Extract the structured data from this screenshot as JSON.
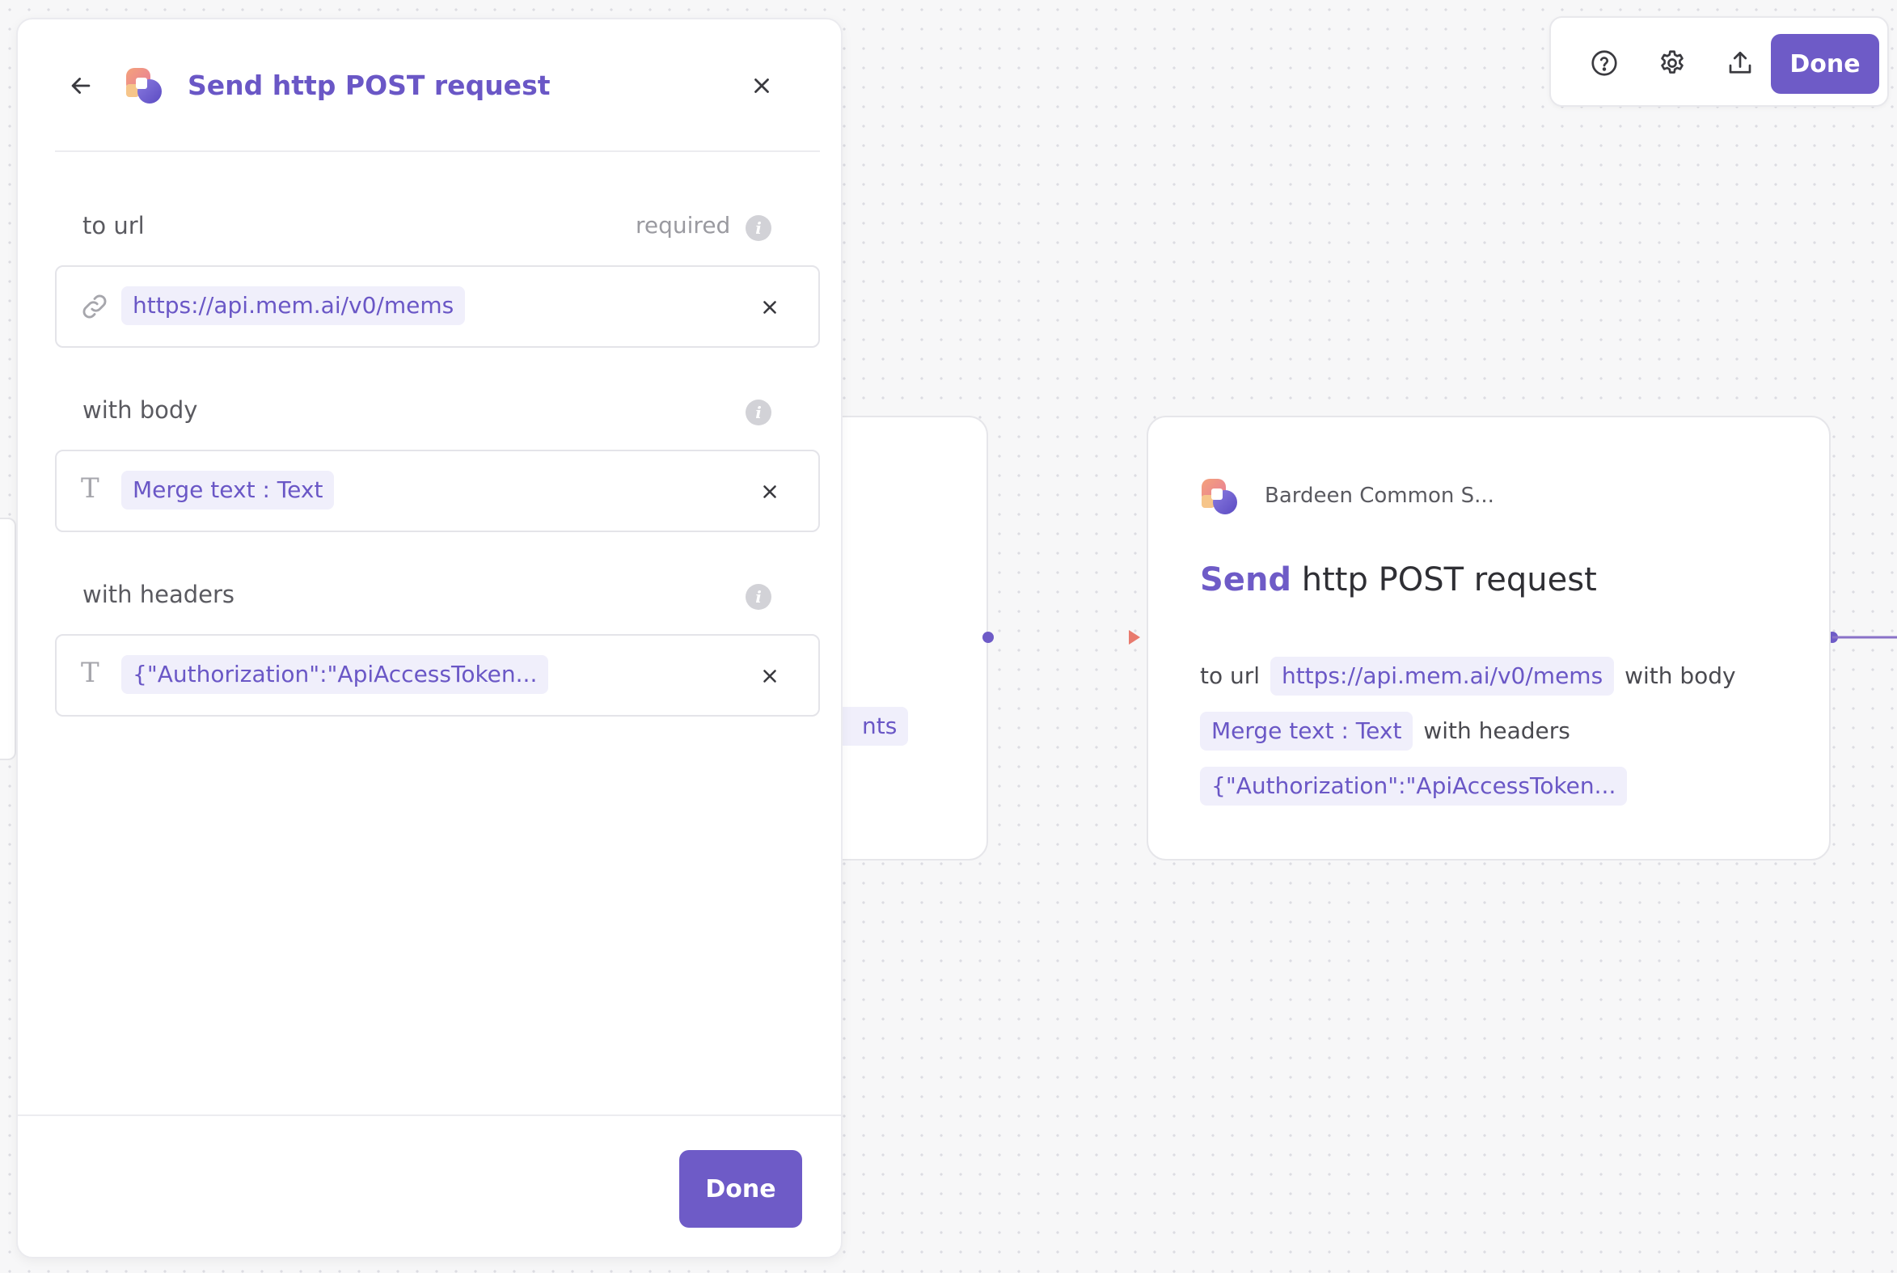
{
  "colors": {
    "accent": "#6e5bc7",
    "chip_bg": "#f0effb",
    "chip_text": "#6a57c6",
    "connector_start": "#6e5bc7",
    "connector_end": "#e87a6e"
  },
  "toolbar": {
    "help_icon": "help-circle-icon",
    "settings_icon": "gear-icon",
    "share_icon": "upload-icon",
    "done_label": "Done"
  },
  "panel": {
    "back_icon": "arrow-left-icon",
    "close_icon": "close-icon",
    "title": "Send http POST request",
    "fields": [
      {
        "label": "to url",
        "required_text": "required",
        "icon": "link-icon",
        "value": "https://api.mem.ai/v0/mems"
      },
      {
        "label": "with body",
        "icon": "text-t-icon",
        "value": "Merge text : Text"
      },
      {
        "label": "with headers",
        "icon": "text-t-icon",
        "value": "{\"Authorization\":\"ApiAccessToken..."
      }
    ],
    "done_label": "Done"
  },
  "canvas": {
    "prev_node_chip_fragment": "nts",
    "node": {
      "app_name": "Bardeen Common S...",
      "title_verb": "Send",
      "title_rest": "http POST request",
      "to_url_label": "to url",
      "url_value": "https://api.mem.ai/v0/mems",
      "with_body_label": "with body",
      "body_value": "Merge text : Text",
      "with_headers_label": "with headers",
      "headers_value": "{\"Authorization\":\"ApiAccessToken..."
    }
  }
}
